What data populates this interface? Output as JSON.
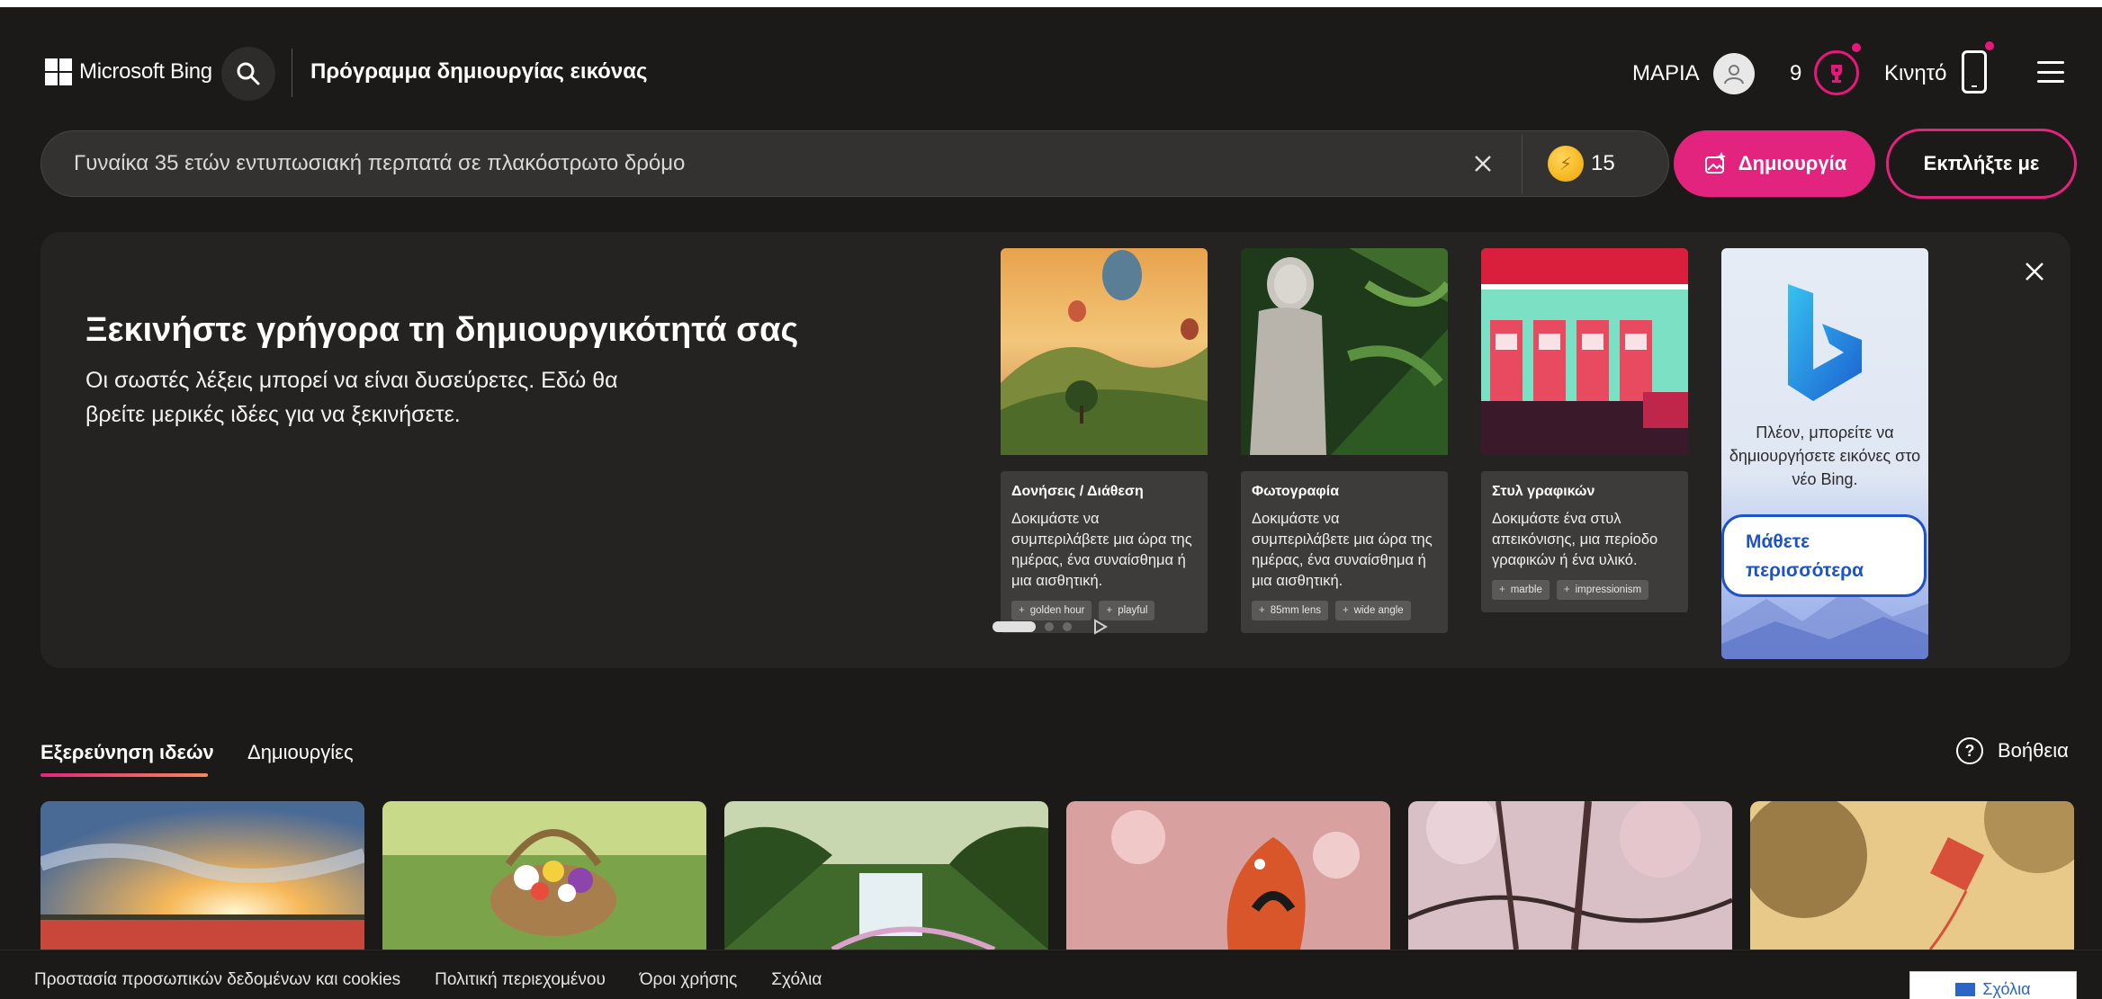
{
  "header": {
    "brand": "Microsoft Bing",
    "title": "Πρόγραμμα δημιουργίας εικόνας",
    "user_name": "ΜΑΡΙΑ",
    "reward_count": "9",
    "mobile_label": "Κινητό"
  },
  "prompt": {
    "text": "Γυναίκα 35 ετών εντυπωσιακή περπατά σε πλακόστρωτο δρόμο",
    "boost_count": "15",
    "create_label": "Δημιουργία",
    "surprise_label": "Εκπλήξτε με"
  },
  "hero": {
    "title": "Ξεκινήστε γρήγορα τη δημιουργικότητά σας",
    "subtitle": "Οι σωστές λέξεις μπορεί να είναι δυσεύρετες. Εδώ θα βρείτε μερικές ιδέες για να ξεκινήσετε.",
    "cards": [
      {
        "heading": "Δονήσεις / Διάθεση",
        "description": "Δοκιμάστε να συμπεριλάβετε μια ώρα της ημέρας, ένα συναίσθημα ή μια αισθητική.",
        "chips": [
          "golden hour",
          "playful"
        ]
      },
      {
        "heading": "Φωτογραφία",
        "description": "Δοκιμάστε να συμπεριλάβετε μια ώρα της ημέρας, ένα συναίσθημα ή μια αισθητική.",
        "chips": [
          "85mm lens",
          "wide angle"
        ]
      },
      {
        "heading": "Στυλ γραφικών",
        "description": "Δοκιμάστε ένα στυλ απεικόνισης, μια περίοδο γραφικών ή ένα υλικό.",
        "chips": [
          "marble",
          "impressionism"
        ]
      }
    ],
    "promo": {
      "text": "Πλέον, μπορείτε να δημιουργήσετε εικόνες στο νέο Bing.",
      "button": "Μάθετε περισσότερα"
    }
  },
  "tabs": {
    "explore": "Εξερεύνηση ιδεών",
    "creations": "Δημιουργίες",
    "help": "Βοήθεια"
  },
  "footer": {
    "links": [
      "Προστασία προσωπικών δεδομένων και cookies",
      "Πολιτική περιεχομένου",
      "Όροι χρήσης",
      "Σχόλια"
    ],
    "feedback": "Σχόλια"
  },
  "colors": {
    "accent": "#e3247e",
    "background": "#1b1a19",
    "panel": "#242322",
    "link_blue": "#1d53c9"
  },
  "icons": [
    "search-icon",
    "user-icon",
    "trophy-icon",
    "mobile-icon",
    "menu-icon",
    "close-icon",
    "coin-icon",
    "sparkle-image-icon",
    "help-icon",
    "chat-icon"
  ]
}
